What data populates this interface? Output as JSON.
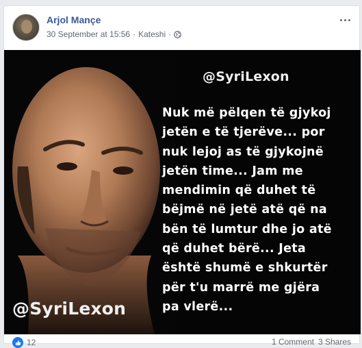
{
  "post": {
    "author": "Arjol Mançe",
    "timestamp": "30 September at 15:56",
    "separator": "·",
    "location": "Kateshi",
    "separator2": "·",
    "privacy_icon": "globe-icon"
  },
  "image": {
    "watermark_top": "@SyriLexon",
    "watermark_bottom": "@SyriLexon",
    "quote": "Nuk më pëlqen të gjykoj\njetën e të tjerëve... por\nnuk lejoj as të gjykojnë\njetën time... Jam me\nmendimin që duhet të\nbëjmë në jetë atë që na\nbën të lumtur dhe jo atë\nqë duhet bërë... Jeta\nështë shumë e shkurtër\npër t'u marrë me gjëra\npa vlerë..."
  },
  "footer": {
    "reaction_count": "12",
    "comments": "1 Comment",
    "shares": "3 Shares"
  },
  "colors": {
    "author_link": "#385898",
    "meta_text": "#616770",
    "like_blue": "#1877f2"
  }
}
